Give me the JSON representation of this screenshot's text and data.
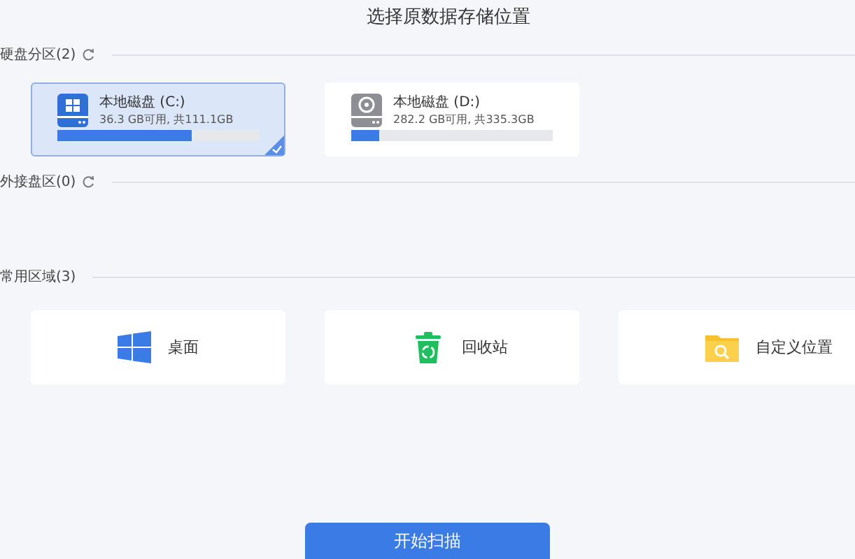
{
  "title": "选择原数据存储位置",
  "disk_section": {
    "label": "硬盘分区(2)",
    "refresh": true,
    "disks": [
      {
        "kind": "system",
        "name": "本地磁盘 (C:)",
        "usage": "36.3 GB可用, 共111.1GB",
        "level": 0.67,
        "selected": true
      },
      {
        "kind": "data",
        "name": "本地磁盘 (D:)",
        "usage": "282.2 GB可用, 共335.3GB",
        "level": 0.14,
        "selected": false
      }
    ]
  },
  "external_section": {
    "label": "外接盘区(0)",
    "refresh": true
  },
  "common_section": {
    "label": "常用区域(3)",
    "items": [
      {
        "kind": "desktop",
        "label": "桌面"
      },
      {
        "kind": "recycle",
        "label": "回收站"
      },
      {
        "kind": "custom",
        "label": "自定义位置"
      }
    ]
  },
  "start_button": "开始扫描"
}
